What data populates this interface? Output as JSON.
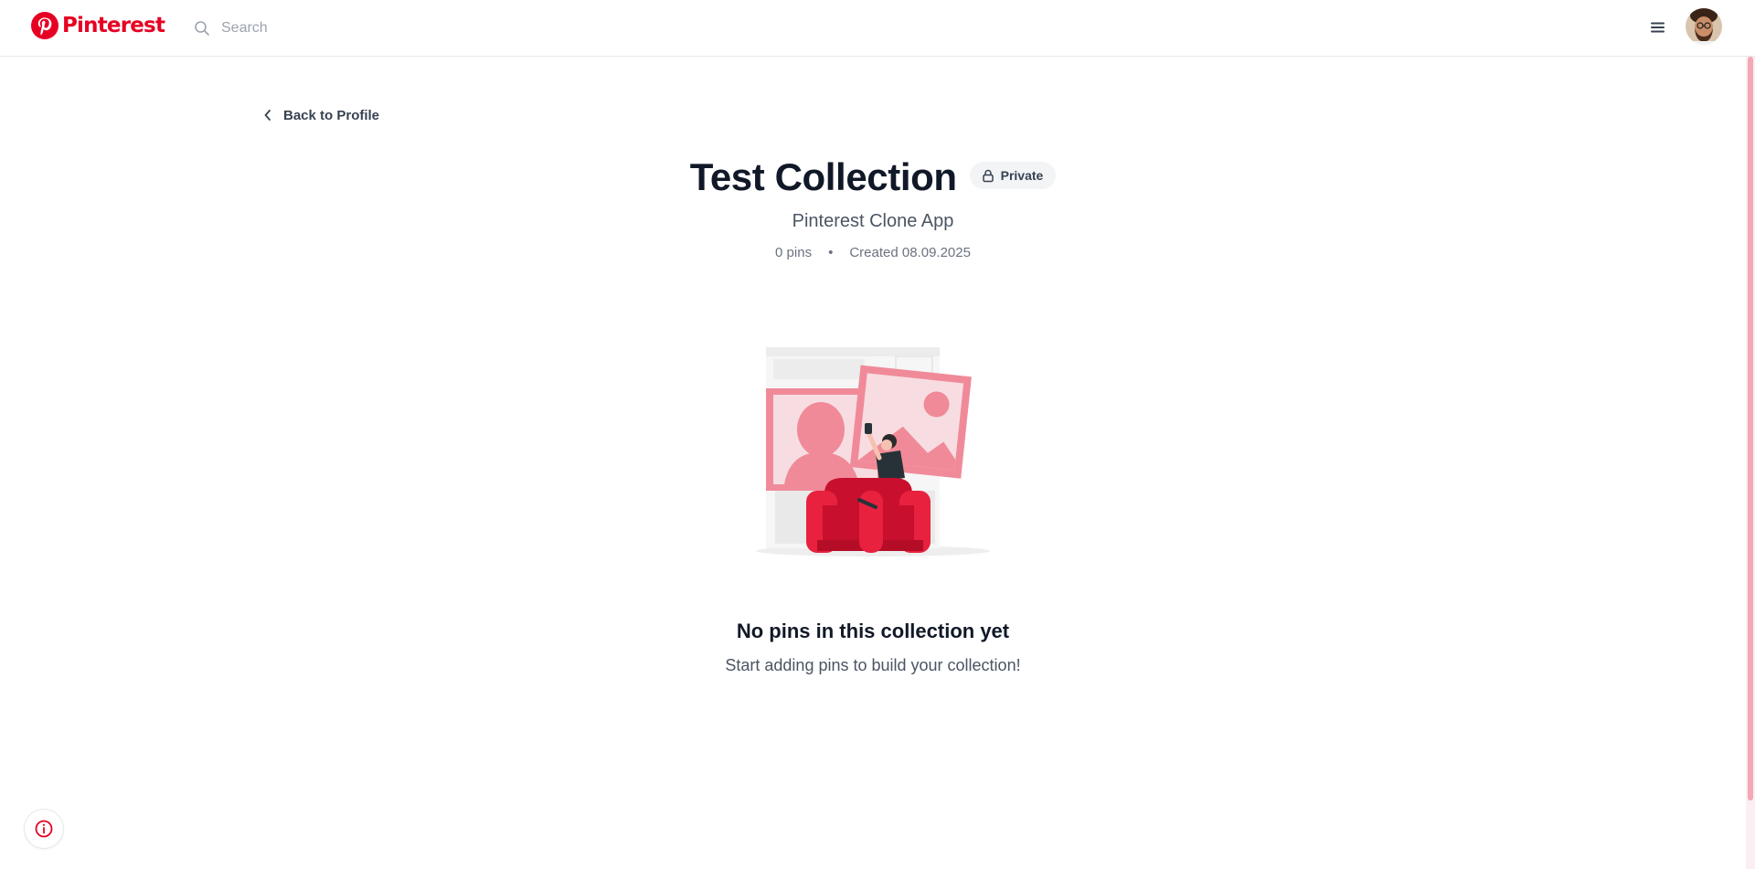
{
  "header": {
    "logo_text": "Pinterest",
    "search_placeholder": "Search",
    "menu_icon": "hamburger-menu-icon",
    "avatar": "user-avatar"
  },
  "nav": {
    "back_label": "Back to Profile"
  },
  "collection": {
    "title": "Test Collection",
    "privacy_badge": "Private",
    "subtitle": "Pinterest Clone App",
    "pin_count": "0 pins",
    "separator": "•",
    "created": "Created 08.09.2025"
  },
  "empty_state": {
    "title": "No pins in this collection yet",
    "message": "Start adding pins to build your collection!"
  },
  "colors": {
    "brand": "#e60023",
    "text_primary": "#111827",
    "text_secondary": "#4b5563",
    "border": "#e5e7eb"
  }
}
